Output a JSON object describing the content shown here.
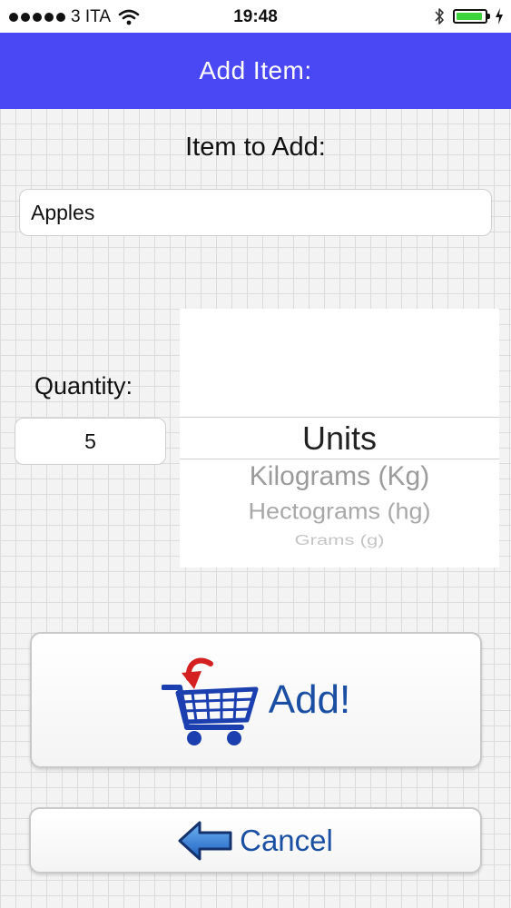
{
  "status_bar": {
    "carrier": "3 ITA",
    "time": "19:48",
    "battery_color": "#3bd43b"
  },
  "nav": {
    "title": "Add Item:",
    "color": "#4a48f5"
  },
  "form": {
    "item_label": "Item to Add:",
    "item_value": "Apples",
    "quantity_label": "Quantity:",
    "quantity_value": "5"
  },
  "unit_picker": {
    "options": [
      "Units",
      "Kilograms (Kg)",
      "Hectograms (hg)",
      "Grams (g)"
    ],
    "selected": "Units"
  },
  "buttons": {
    "add_label": "Add!",
    "cancel_label": "Cancel",
    "accent_color": "#1a4fa3"
  },
  "icons": {
    "cart": "shopping-cart-icon",
    "cancel": "left-arrow-icon"
  }
}
